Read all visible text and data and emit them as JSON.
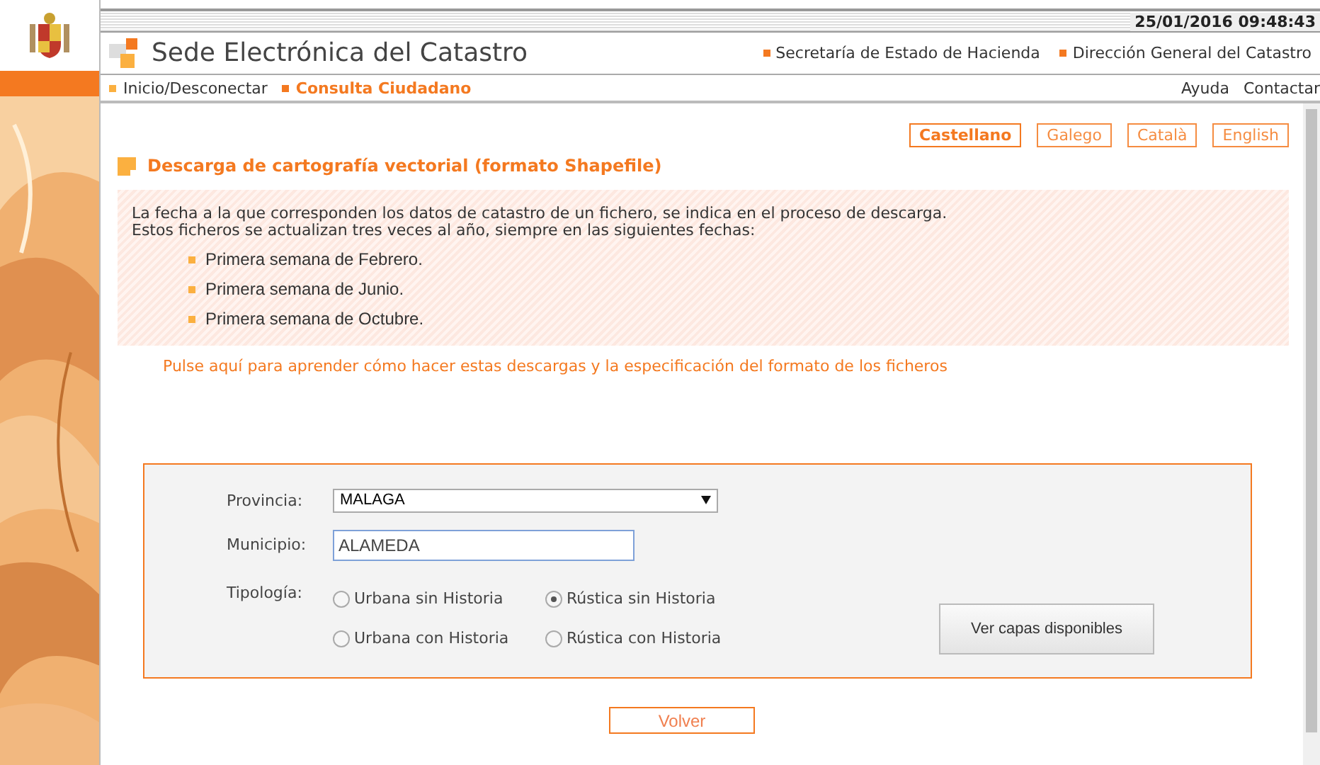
{
  "header": {
    "datetime": "25/01/2016 09:48:43",
    "site_title": "Sede Electrónica del Catastro",
    "links": [
      "Secretaría de Estado de Hacienda",
      "Dirección General del Catastro"
    ]
  },
  "nav": {
    "items": [
      {
        "label": "Inicio/Desconectar",
        "selected": false
      },
      {
        "label": "Consulta Ciudadano",
        "selected": true
      }
    ],
    "right_links": [
      "Ayuda",
      "Contactar"
    ]
  },
  "languages": [
    {
      "label": "Castellano",
      "selected": true
    },
    {
      "label": "Galego",
      "selected": false
    },
    {
      "label": "Català",
      "selected": false
    },
    {
      "label": "English",
      "selected": false
    }
  ],
  "section_title": "Descarga de cartografía vectorial (formato Shapefile)",
  "info": {
    "lines": [
      "La fecha a la que corresponden los datos de catastro de un fichero, se indica en el proceso de descarga.",
      "Estos ficheros se actualizan tres veces al año, siempre en las siguientes fechas:"
    ],
    "dates": [
      "Primera semana de Febrero.",
      "Primera semana de Junio.",
      "Primera semana de Octubre."
    ]
  },
  "help_link": "Pulse aquí para aprender cómo hacer estas descargas y la especificación del formato de los ficheros",
  "form": {
    "provincia": {
      "label": "Provincia:",
      "value": "MALAGA"
    },
    "municipio": {
      "label": "Municipio:",
      "value": "ALAMEDA"
    },
    "tipologia": {
      "label": "Tipología:",
      "options": [
        {
          "label": "Urbana sin Historia",
          "selected": false
        },
        {
          "label": "Rústica sin Historia",
          "selected": true
        },
        {
          "label": "Urbana con Historia",
          "selected": false
        },
        {
          "label": "Rústica con Historia",
          "selected": false
        }
      ]
    },
    "submit": "Ver capas disponibles"
  },
  "back_button": "Volver"
}
